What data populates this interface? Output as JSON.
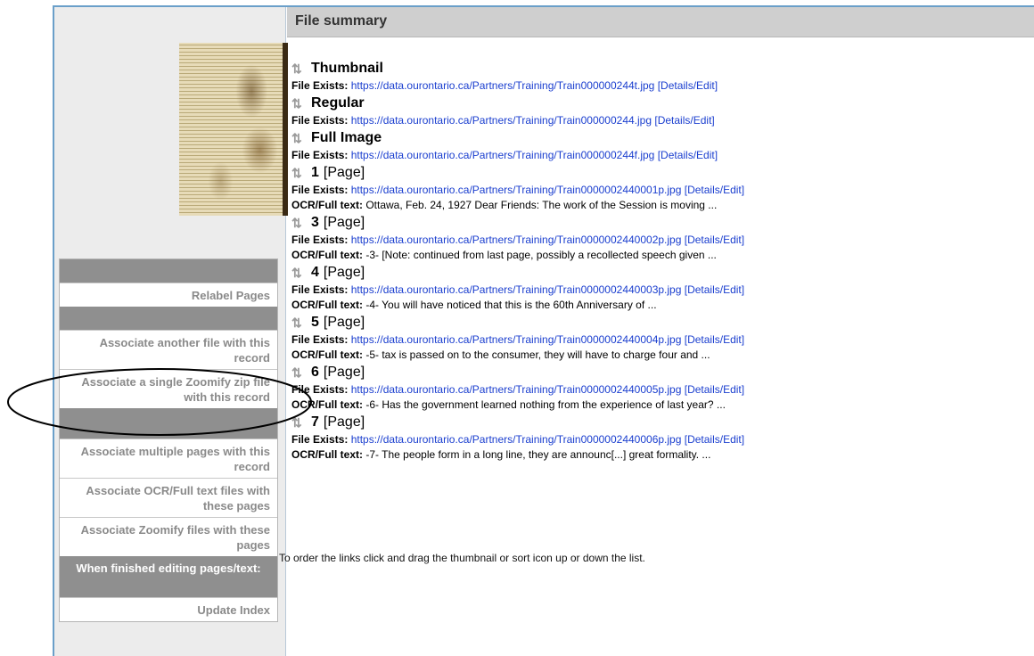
{
  "header": {
    "title": "File summary"
  },
  "sidebar": {
    "thumbnail_alt": "document thumbnail",
    "menu": [
      {
        "type": "head",
        "label": ""
      },
      {
        "type": "item",
        "label": "Relabel Pages"
      },
      {
        "type": "head",
        "label": ""
      },
      {
        "type": "item",
        "label": "Associate another file with this record"
      },
      {
        "type": "item",
        "label": "Associate a single Zoomify zip file with this record"
      },
      {
        "type": "head",
        "label": ""
      },
      {
        "type": "item",
        "label": "Associate multiple pages with this record"
      },
      {
        "type": "item",
        "label": "Associate OCR/Full text files with these pages"
      },
      {
        "type": "item",
        "label": "Associate Zoomify files with these pages"
      },
      {
        "type": "head",
        "label": "When finished editing pages/text:"
      },
      {
        "type": "item",
        "label": "Update Index"
      }
    ]
  },
  "labels": {
    "file_exists": "File Exists:",
    "ocr": "OCR/Full text:",
    "details_edit": "[Details/Edit]",
    "page_suffix": "[Page]",
    "sort_icon": "sort-arrows-icon"
  },
  "entries": [
    {
      "title": "Thumbnail",
      "page": false,
      "url": "https://data.ourontario.ca/Partners/Training/Train000000244t.jpg",
      "ocr": ""
    },
    {
      "title": "Regular",
      "page": false,
      "url": "https://data.ourontario.ca/Partners/Training/Train000000244.jpg",
      "ocr": ""
    },
    {
      "title": "Full Image",
      "page": false,
      "url": "https://data.ourontario.ca/Partners/Training/Train000000244f.jpg",
      "ocr": ""
    },
    {
      "title": "1",
      "page": true,
      "url": "https://data.ourontario.ca/Partners/Training/Train0000002440001p.jpg",
      "ocr": "Ottawa, Feb. 24, 1927 Dear Friends: The work of the Session is moving ..."
    },
    {
      "title": "3",
      "page": true,
      "url": "https://data.ourontario.ca/Partners/Training/Train0000002440002p.jpg",
      "ocr": "-3- [Note: continued from last page, possibly a recollected speech given ..."
    },
    {
      "title": "4",
      "page": true,
      "url": "https://data.ourontario.ca/Partners/Training/Train0000002440003p.jpg",
      "ocr": "-4- You will have noticed that this is the 60th Anniversary of ..."
    },
    {
      "title": "5",
      "page": true,
      "url": "https://data.ourontario.ca/Partners/Training/Train0000002440004p.jpg",
      "ocr": "-5- tax is passed on to the consumer, they will have to charge four and ..."
    },
    {
      "title": "6",
      "page": true,
      "url": "https://data.ourontario.ca/Partners/Training/Train0000002440005p.jpg",
      "ocr": "-6- Has the government learned nothing from the experience of last year? ..."
    },
    {
      "title": "7",
      "page": true,
      "url": "https://data.ourontario.ca/Partners/Training/Train0000002440006p.jpg",
      "ocr": "-7- The people form in a long line, they are announc[...] great formality. ..."
    }
  ],
  "footer_note": "To order the links click and drag the thumbnail or sort icon up or down the list."
}
